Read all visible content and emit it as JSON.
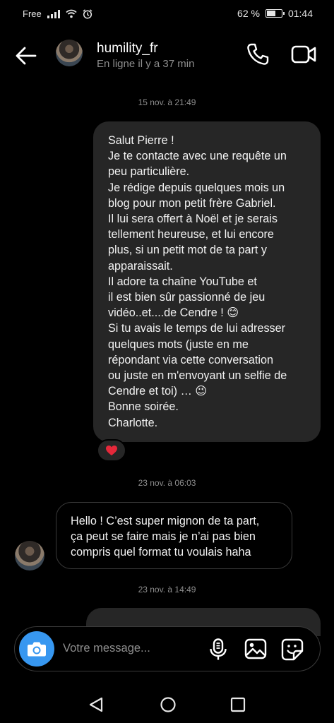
{
  "status_bar": {
    "carrier": "Free",
    "battery_text": "62 %",
    "battery_level": 0.62,
    "time": "01:44"
  },
  "header": {
    "username": "humility_fr",
    "status": "En ligne il y a 37 min"
  },
  "messages": [
    {
      "timestamp": "15 nov. à 21:49",
      "direction": "outgoing",
      "lines": [
        "Salut Pierre !",
        "Je te contacte avec une requête un",
        "peu particulière.",
        "Je rédige depuis quelques mois un",
        "blog pour mon petit frère Gabriel.",
        "Il lui sera offert à Noël et je serais",
        "tellement heureuse, et lui encore",
        "plus, si un petit mot de ta part y",
        "apparaissait.",
        "Il adore ta chaîne YouTube et",
        "il est bien sûr passionné de jeu",
        "vidéo..et....de Cendre ! 😊",
        "Si tu avais le temps de lui adresser",
        "quelques mots (juste en me",
        "répondant via cette conversation",
        "ou juste en m'envoyant un selfie de",
        "Cendre et toi) … 😉",
        "Bonne soirée.",
        "Charlotte."
      ],
      "reaction": "❤️"
    },
    {
      "timestamp": "23 nov. à 06:03",
      "direction": "incoming",
      "lines": [
        "Hello ! C’est super mignon de ta part,",
        "ça peut se faire mais je n’ai pas bien",
        "compris quel format tu voulais haha"
      ]
    },
    {
      "timestamp": "23 nov. à 14:49",
      "direction": "outgoing"
    }
  ],
  "composer": {
    "placeholder": "Votre message..."
  },
  "colors": {
    "accent": "#3797f0",
    "bubble_out": "#262626",
    "muted_text": "#8e8e8e"
  }
}
